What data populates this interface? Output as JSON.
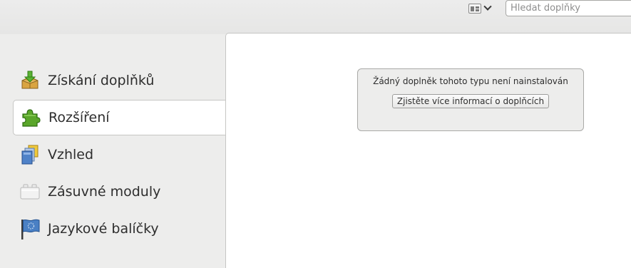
{
  "toolbar": {
    "view_icon": "view-grid-icon",
    "search_placeholder": "Hledat doplňky"
  },
  "sidebar": {
    "items": [
      {
        "label": "Získání doplňků",
        "icon": "get-addons-icon",
        "selected": false
      },
      {
        "label": "Rozšíření",
        "icon": "puzzle-piece-icon",
        "selected": true
      },
      {
        "label": "Vzhled",
        "icon": "appearance-icon",
        "selected": false
      },
      {
        "label": "Zásuvné moduly",
        "icon": "plugin-brick-icon",
        "selected": false
      },
      {
        "label": "Jazykové balíčky",
        "icon": "flag-icon",
        "selected": false
      }
    ]
  },
  "main": {
    "empty_message": "Žádný doplněk tohoto typu není nainstalován",
    "learn_more_label": "Zjistěte více informací o doplňcích"
  },
  "colors": {
    "background": "#ededec",
    "panel": "#ffffff",
    "border": "#c6c6c4",
    "puzzle_green": "#5aa62a"
  }
}
